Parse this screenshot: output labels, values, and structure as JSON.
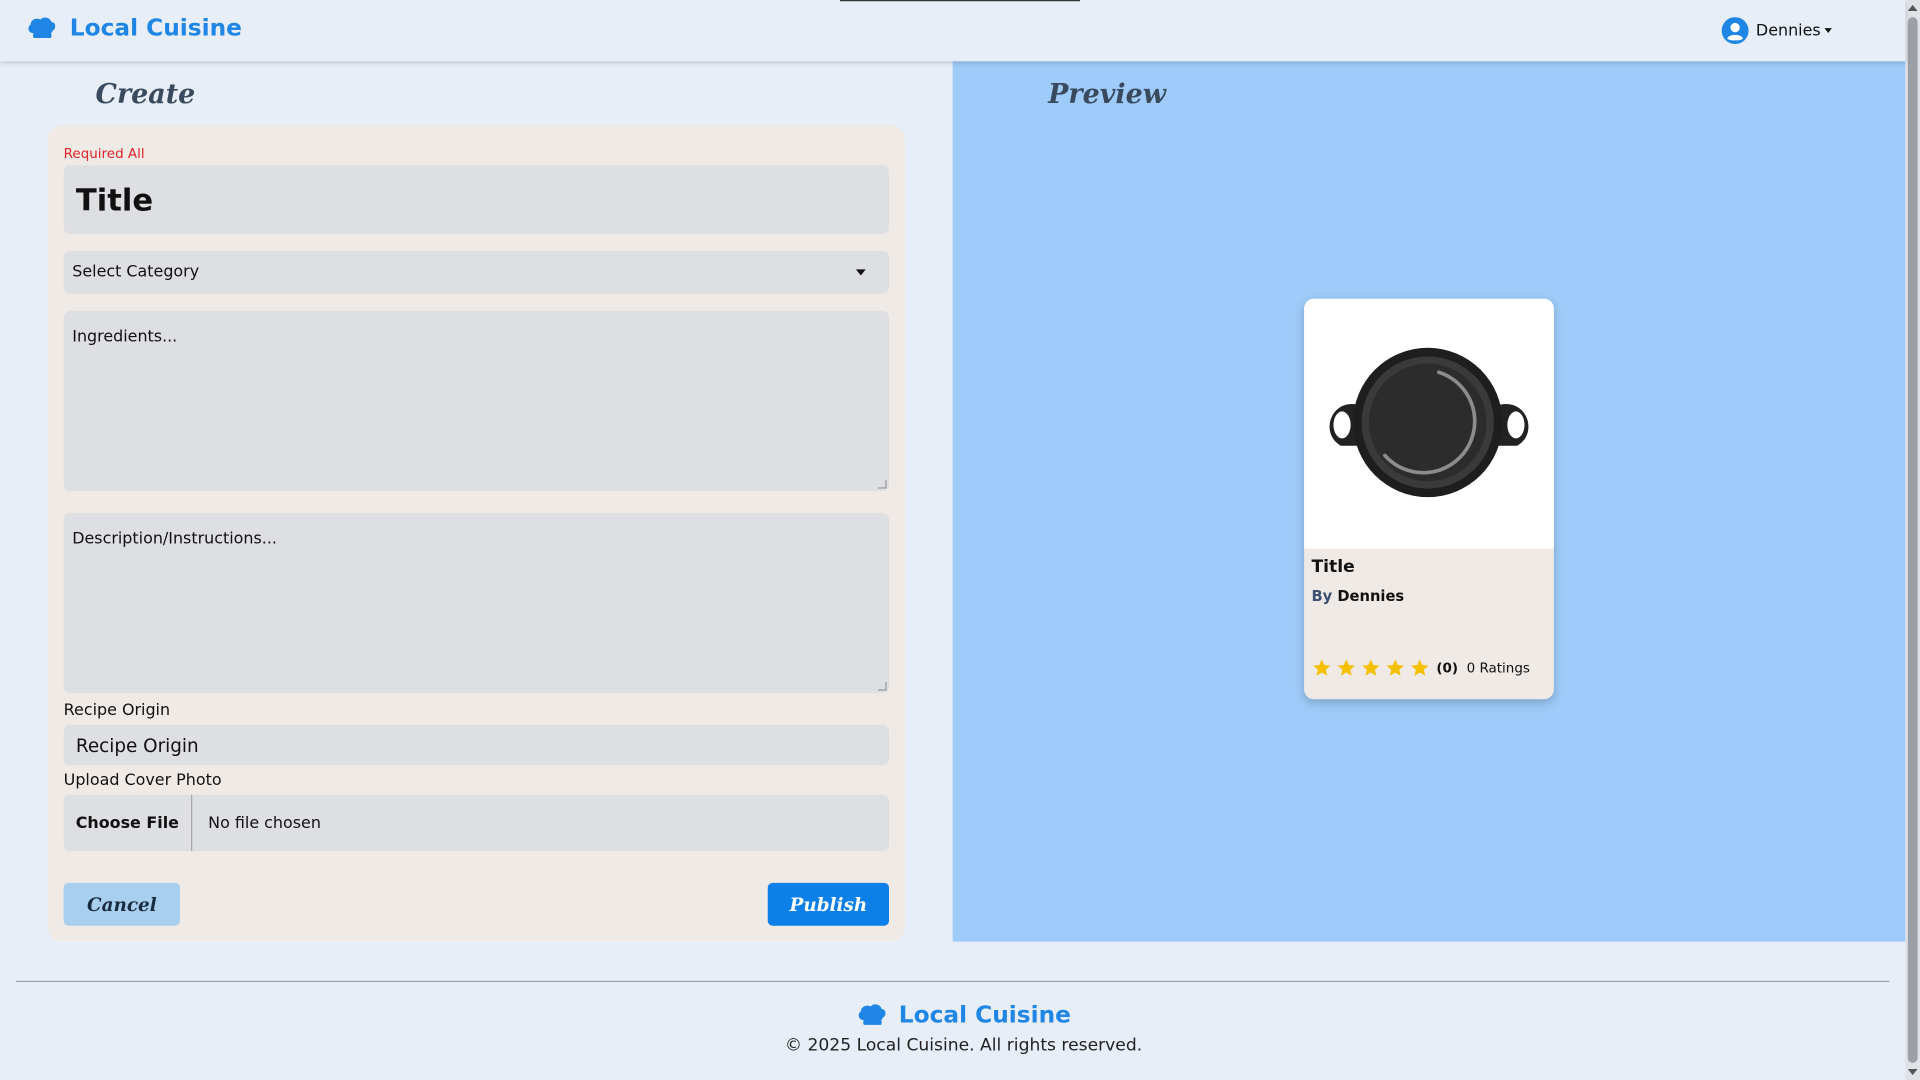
{
  "header": {
    "brand": "Local Cuisine",
    "user_name": "Dennies"
  },
  "create": {
    "title": "Create",
    "required_note": "Required All",
    "title_placeholder": "Title",
    "category_placeholder": "Select Category",
    "ingredients_placeholder": "Ingredients...",
    "description_placeholder": "Description/Instructions...",
    "origin_label": "Recipe Origin",
    "origin_placeholder": "Recipe Origin",
    "upload_label": "Upload Cover Photo",
    "choose_file": "Choose File",
    "no_file": "No file chosen",
    "cancel": "Cancel",
    "publish": "Publish"
  },
  "preview": {
    "title": "Preview",
    "card": {
      "title": "Title",
      "by": "By",
      "author": "Dennies",
      "rating_count": "(0)",
      "ratings_text": "0 Ratings",
      "stars": 5
    }
  },
  "footer": {
    "brand": "Local Cuisine",
    "copyright": "© 2025 Local Cuisine. All rights reserved."
  },
  "colors": {
    "accent": "#1f86e6",
    "publish": "#0d7fe8",
    "cancel": "#a9cfee",
    "preview_bg": "#9ecbf9",
    "required": "#e0242a",
    "star": "#f5c000"
  }
}
